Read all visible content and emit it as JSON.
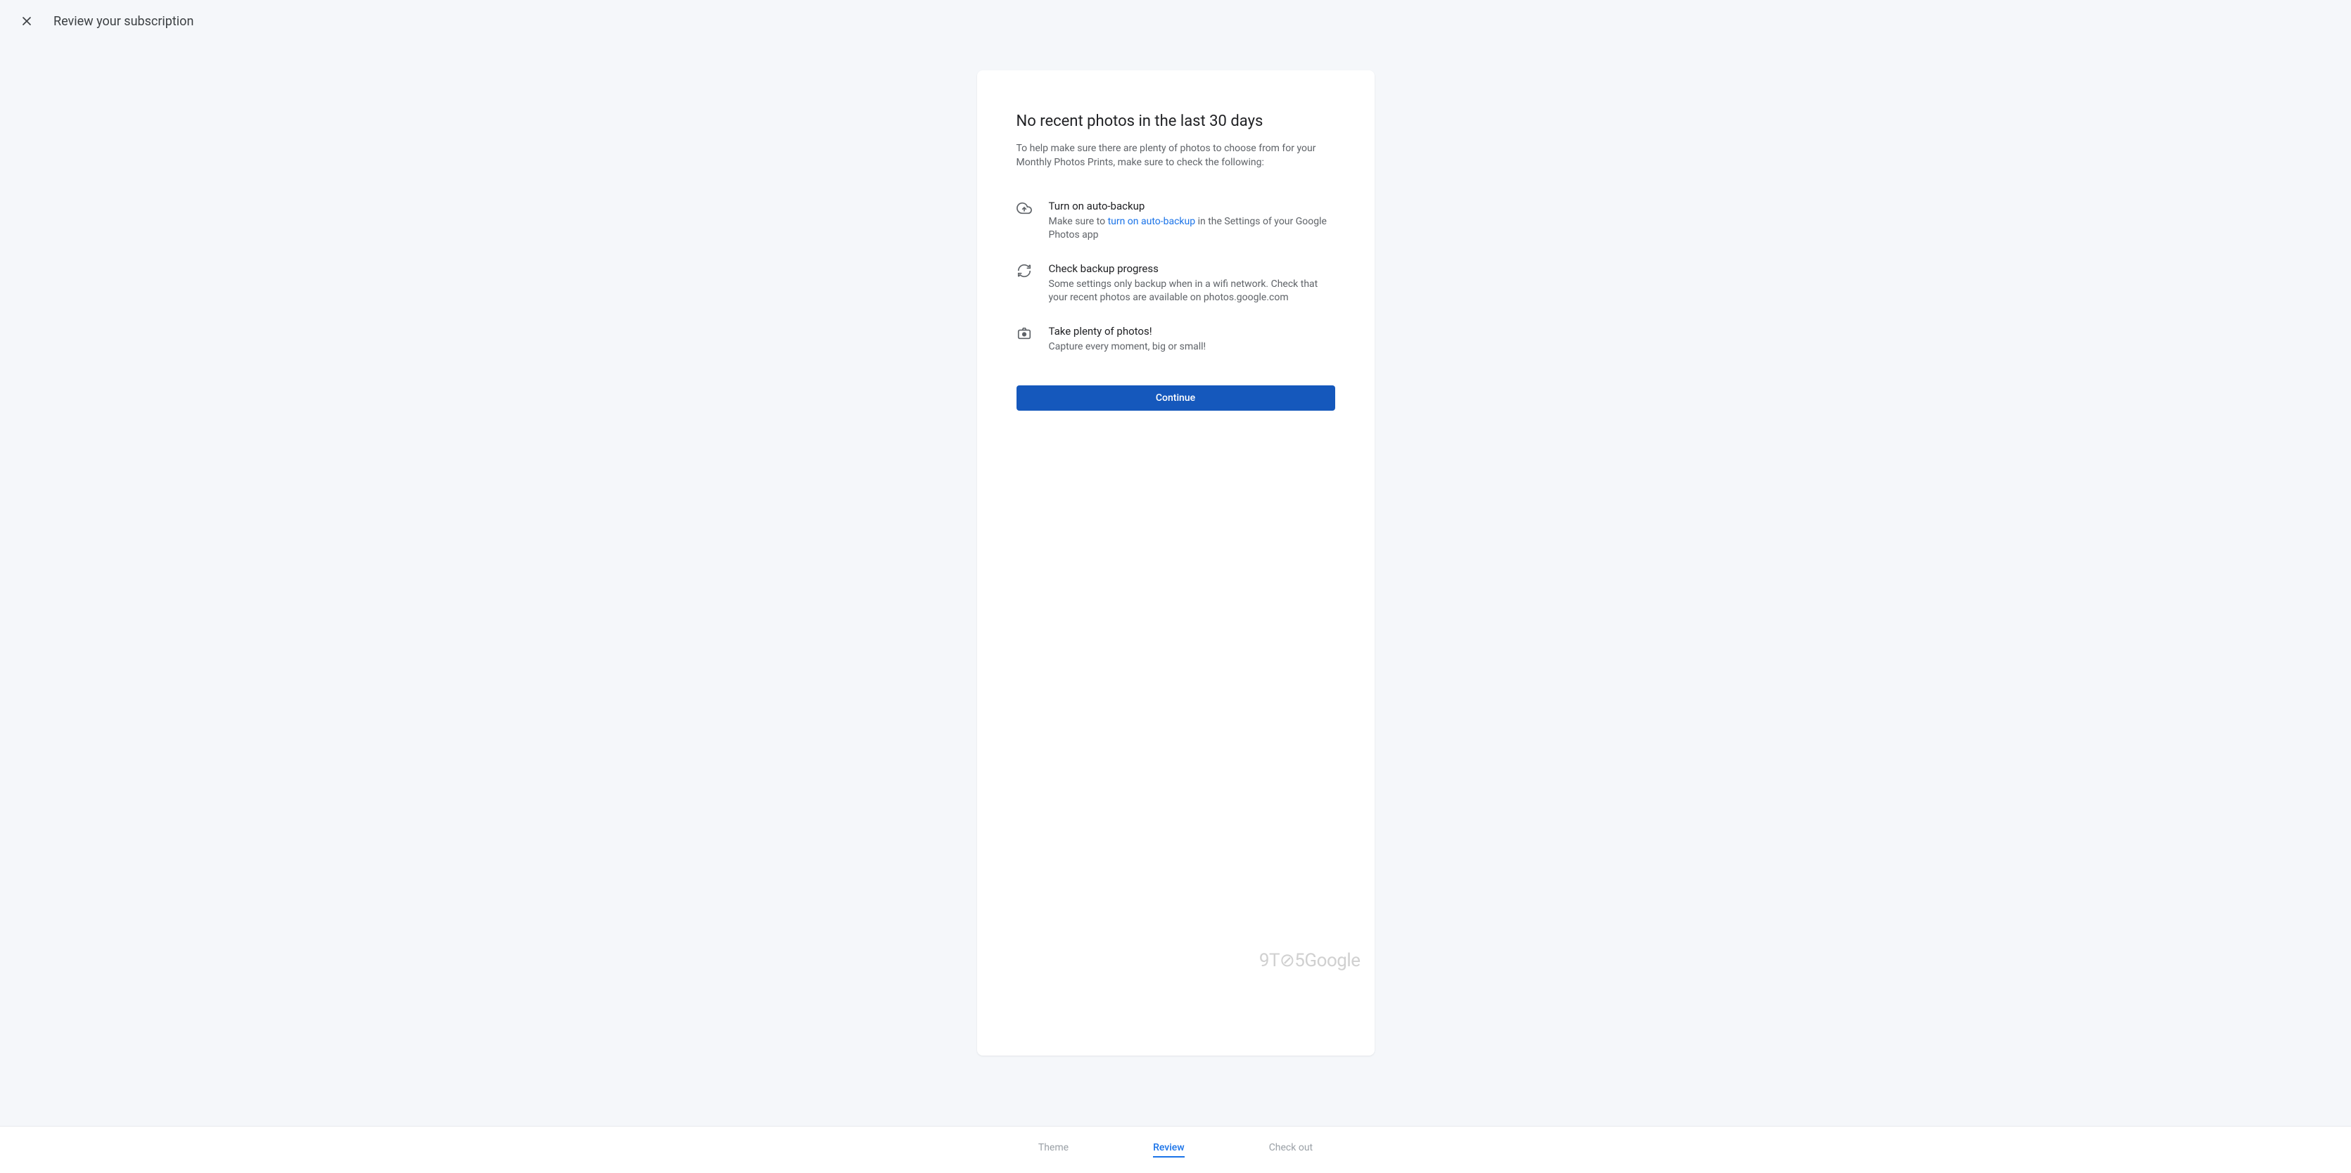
{
  "header": {
    "title": "Review your subscription"
  },
  "card": {
    "heading": "No recent photos in the last 30 days",
    "description": "To help make sure there are plenty of photos to choose from for your Monthly Photos Prints, make sure to check the following:",
    "items": [
      {
        "title": "Turn on auto-backup",
        "text_before": "Make sure to ",
        "link_text": "turn on auto-backup",
        "text_after": " in the Settings of your Google Photos app"
      },
      {
        "title": "Check backup progress",
        "text": "Some settings only backup when in a wifi network. Check that your recent photos are available on photos.google.com"
      },
      {
        "title": "Take plenty of photos!",
        "text": "Capture every moment, big or small!"
      }
    ],
    "button": "Continue"
  },
  "watermark": "9T⊘5Google",
  "footer": {
    "tabs": [
      {
        "label": "Theme",
        "active": false
      },
      {
        "label": "Review",
        "active": true
      },
      {
        "label": "Check out",
        "active": false
      }
    ]
  }
}
